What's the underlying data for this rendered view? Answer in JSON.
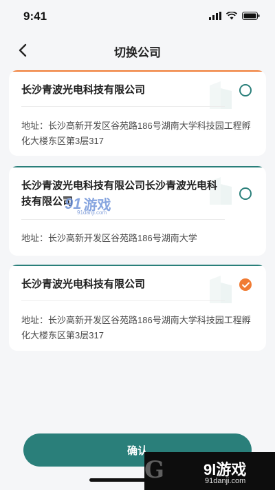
{
  "status_bar": {
    "time": "9:41"
  },
  "nav": {
    "title": "切换公司"
  },
  "companies": [
    {
      "name": "长沙青波光电科技有限公司",
      "address": "地址：长沙高新开发区谷苑路186号湖南大学科技园工程孵化大楼东区第3层317",
      "selected": false
    },
    {
      "name": "长沙青波光电科技有限公司长沙青波光电科技有限公司",
      "address": "地址：长沙高新开发区谷苑路186号湖南大学",
      "selected": false
    },
    {
      "name": "长沙青波光电科技有限公司",
      "address": "地址：长沙高新开发区谷苑路186号湖南大学科技园工程孵化大楼东区第3层317",
      "selected": true
    }
  ],
  "confirm_button": {
    "label": "确认"
  },
  "watermark": {
    "mid_logo": "91",
    "mid_text": "游戏",
    "mid_url": "91danji.com",
    "corner_logo": "G",
    "corner_title": "9l游戏",
    "corner_url": "91danji.com"
  },
  "colors": {
    "accent": "#2a7f7a",
    "selected": "#f07b33",
    "background": "#f5f6f8"
  }
}
